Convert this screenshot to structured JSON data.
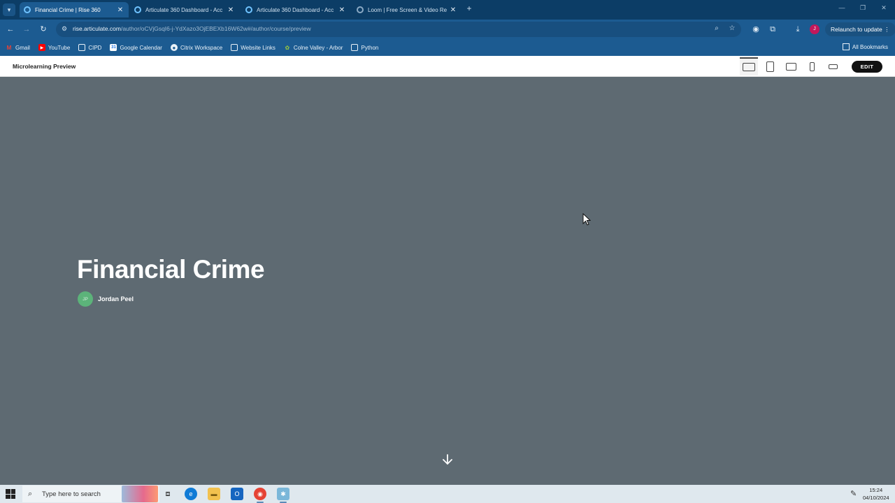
{
  "browser": {
    "tabs": [
      {
        "title": "Financial Crime | Rise 360",
        "active": true
      },
      {
        "title": "Articulate 360 Dashboard - Acc",
        "active": false
      },
      {
        "title": "Articulate 360 Dashboard - Acc",
        "active": false
      },
      {
        "title": "Loom | Free Screen & Video Re",
        "active": false
      }
    ],
    "url_host": "rise.articulate.com",
    "url_path": "/author/oCVjGsqI6-j-YdXazo3OjEBEXb16W62w#/author/course/preview",
    "profile_initial": "J",
    "relaunch_label": "Relaunch to update",
    "bookmarks": [
      {
        "label": "Gmail",
        "icon": "gmail-icon"
      },
      {
        "label": "YouTube",
        "icon": "youtube-icon"
      },
      {
        "label": "CIPD",
        "icon": "folder-icon"
      },
      {
        "label": "Google Calendar",
        "icon": "calendar-icon"
      },
      {
        "label": "Citrix Workspace",
        "icon": "citrix-icon"
      },
      {
        "label": "Website Links",
        "icon": "folder-icon"
      },
      {
        "label": "Colne Valley - Arbor",
        "icon": "arbor-icon"
      },
      {
        "label": "Python",
        "icon": "folder-icon"
      }
    ],
    "all_bookmarks_label": "All Bookmarks"
  },
  "preview": {
    "title": "Microlearning Preview",
    "edit_label": "EDIT",
    "active_device": "desktop"
  },
  "course": {
    "title": "Financial Crime",
    "author_initials": "JP",
    "author_name": "Jordan Peel"
  },
  "taskbar": {
    "search_placeholder": "Type here to search",
    "time": "15:24",
    "date": "04/10/2024"
  },
  "colors": {
    "cover_bg": "#5e6a72",
    "chrome_dark": "#0c3d66",
    "chrome": "#1c5b91",
    "avatar_green": "#5cb37a"
  }
}
